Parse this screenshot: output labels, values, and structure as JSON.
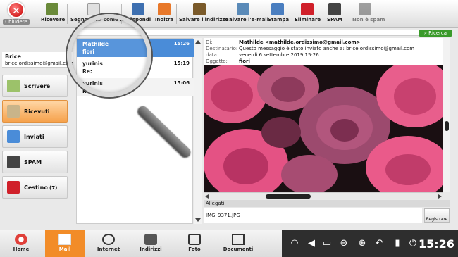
{
  "toolbar": {
    "close_label": "Chiudere",
    "buttons": [
      {
        "label": "Ricevere",
        "icon": "receive-icon"
      },
      {
        "label": "Segna tutti come letti",
        "icon": "mark-read-icon"
      },
      {
        "label": "Rispondi",
        "icon": "reply-icon"
      },
      {
        "label": "Inoltra",
        "icon": "forward-icon"
      },
      {
        "label": "Salvare l'indirizzo",
        "icon": "save-address-icon"
      },
      {
        "label": "Salvare l'e-mail",
        "icon": "save-email-icon"
      },
      {
        "label": "Stampa",
        "icon": "print-icon"
      },
      {
        "label": "Eliminare",
        "icon": "delete-icon"
      },
      {
        "label": "SPAM",
        "icon": "spam-icon"
      },
      {
        "label": "Non è spam",
        "icon": "not-spam-icon"
      }
    ]
  },
  "search": {
    "button_label": "Ricerca",
    "value": ""
  },
  "user": {
    "name": "Brice",
    "email": "brice.ordissimo@gmail.com"
  },
  "folders": [
    {
      "label": "Scrivere"
    },
    {
      "label": "Ricevuti"
    },
    {
      "label": "Inviati"
    },
    {
      "label": "SPAM"
    },
    {
      "label": "Cestino",
      "count": "(7)"
    }
  ],
  "messages": [
    {
      "from": "Mathilde",
      "subject": "fiori",
      "time": "15:26"
    },
    {
      "from": "yurinis",
      "subject": "Re:",
      "time": "15:19"
    },
    {
      "from": "yurinis",
      "subject": "Re:",
      "time": "15:06"
    }
  ],
  "header": {
    "from_label": "Di:",
    "from_value": "Mathilde <mathilde.ordissimo@gmail.com>",
    "to_label": "Destinatario:",
    "to_value": "Questo messaggio è stato inviato anche a: brice.ordissimo@gmail.com",
    "date_label": "data",
    "date_value": "venerdì 6 settembre 2019 15:26",
    "subject_label": "Oggetto:",
    "subject_value": "fiori"
  },
  "attachments": {
    "label": "Allegati:",
    "file": "IMG_9371.JPG",
    "save_label": "Registrare"
  },
  "taskbar": {
    "apps": [
      {
        "label": "Home"
      },
      {
        "label": "Mail"
      },
      {
        "label": "Internet"
      },
      {
        "label": "Indirizzi"
      },
      {
        "label": "Foto"
      },
      {
        "label": "Documenti"
      }
    ],
    "clock": "15:26"
  },
  "colors": {
    "accent": "#f28c28",
    "selected": "#4a8cd8",
    "search": "#3a9a2a"
  }
}
